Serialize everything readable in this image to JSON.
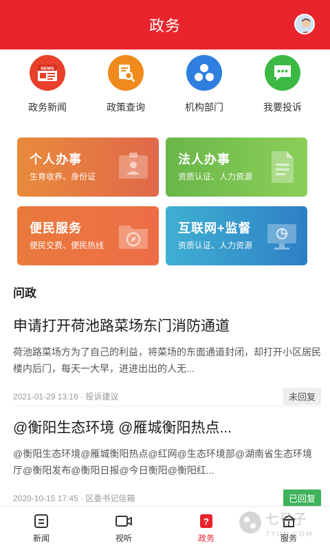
{
  "header": {
    "title": "政务"
  },
  "quick_links": [
    {
      "label": "政务新闻",
      "icon": "news-icon",
      "color": "#e8402a",
      "icon_text": "NEWS"
    },
    {
      "label": "政策查询",
      "icon": "policy-search-icon",
      "color": "#f08a1c"
    },
    {
      "label": "机构部门",
      "icon": "organization-icon",
      "color": "#2f7fe0"
    },
    {
      "label": "我要投诉",
      "icon": "complaint-icon",
      "color": "#3cb944"
    }
  ],
  "service_cards": [
    {
      "title": "个人办事",
      "sub": "生育收养、身份证"
    },
    {
      "title": "法人办事",
      "sub": "资质认证、人力资源"
    },
    {
      "title": "便民服务",
      "sub": "便民交费、便民热线"
    },
    {
      "title": "互联网+监督",
      "sub": "资质认证、人力资源"
    }
  ],
  "section": {
    "title": "问政"
  },
  "posts": [
    {
      "title": "申请打开荷池路菜场东门消防通道",
      "body": "荷池路菜场方为了自己的利益，将菜场的东面通道封闭，却打开小区居民楼内后门，每天一大早，进进出出的人无...",
      "meta": "2021-01-29 13:16 · 投诉建议",
      "status": "未回复"
    },
    {
      "title": "@衡阳生态环境 @雁城衡阳热点...",
      "body": "@衡阳生态环境@雁城衡阳热点@红网@生态环境部@湖南省生态环境厅@衡阳发布@衡阳日报@今日衡阳@衡阳红...",
      "meta": "2020-10-15 17:45 · 区委书记信箱",
      "status": "已回复"
    }
  ],
  "tabs": [
    {
      "label": "新闻",
      "icon": "news-tab-icon"
    },
    {
      "label": "视听",
      "icon": "video-tab-icon"
    },
    {
      "label": "政务",
      "icon": "government-tab-icon",
      "active": true
    },
    {
      "label": "服务",
      "icon": "service-tab-icon"
    }
  ],
  "watermark": {
    "text": "七号子",
    "url": "7YUN.COM"
  },
  "colors": {
    "brand_red": "#e8242d",
    "green": "#3eb35b"
  }
}
